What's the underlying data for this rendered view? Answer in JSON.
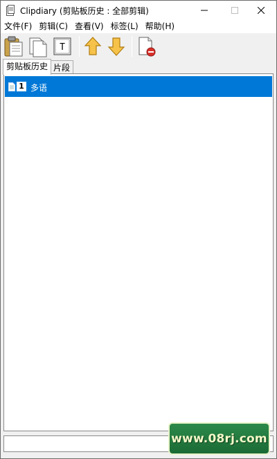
{
  "window": {
    "title": "Clipdiary (剪贴板历史 : 全部剪辑)"
  },
  "menu": {
    "items": [
      {
        "label": "文件(F)"
      },
      {
        "label": "剪辑(C)"
      },
      {
        "label": "查看(V)"
      },
      {
        "label": "标签(L)"
      },
      {
        "label": "帮助(H)"
      }
    ]
  },
  "toolbar": {
    "buttons": [
      {
        "icon": "paste-icon"
      },
      {
        "icon": "copy-icon"
      },
      {
        "icon": "plain-text-icon",
        "glyph": "T"
      },
      {
        "icon": "arrow-up-icon"
      },
      {
        "icon": "arrow-down-icon"
      },
      {
        "icon": "delete-icon"
      }
    ]
  },
  "tabs": [
    {
      "label": "剪贴板历史",
      "active": true
    },
    {
      "label": "片段",
      "active": false
    }
  ],
  "list": {
    "rows": [
      {
        "index": "1",
        "text": "多语",
        "selected": true
      }
    ]
  },
  "watermark": {
    "text": "www.08rj.com"
  },
  "colors": {
    "selection": "#0078d7",
    "watermark_bg": "#1f7a3e",
    "watermark_text": "#f4f9c8"
  }
}
